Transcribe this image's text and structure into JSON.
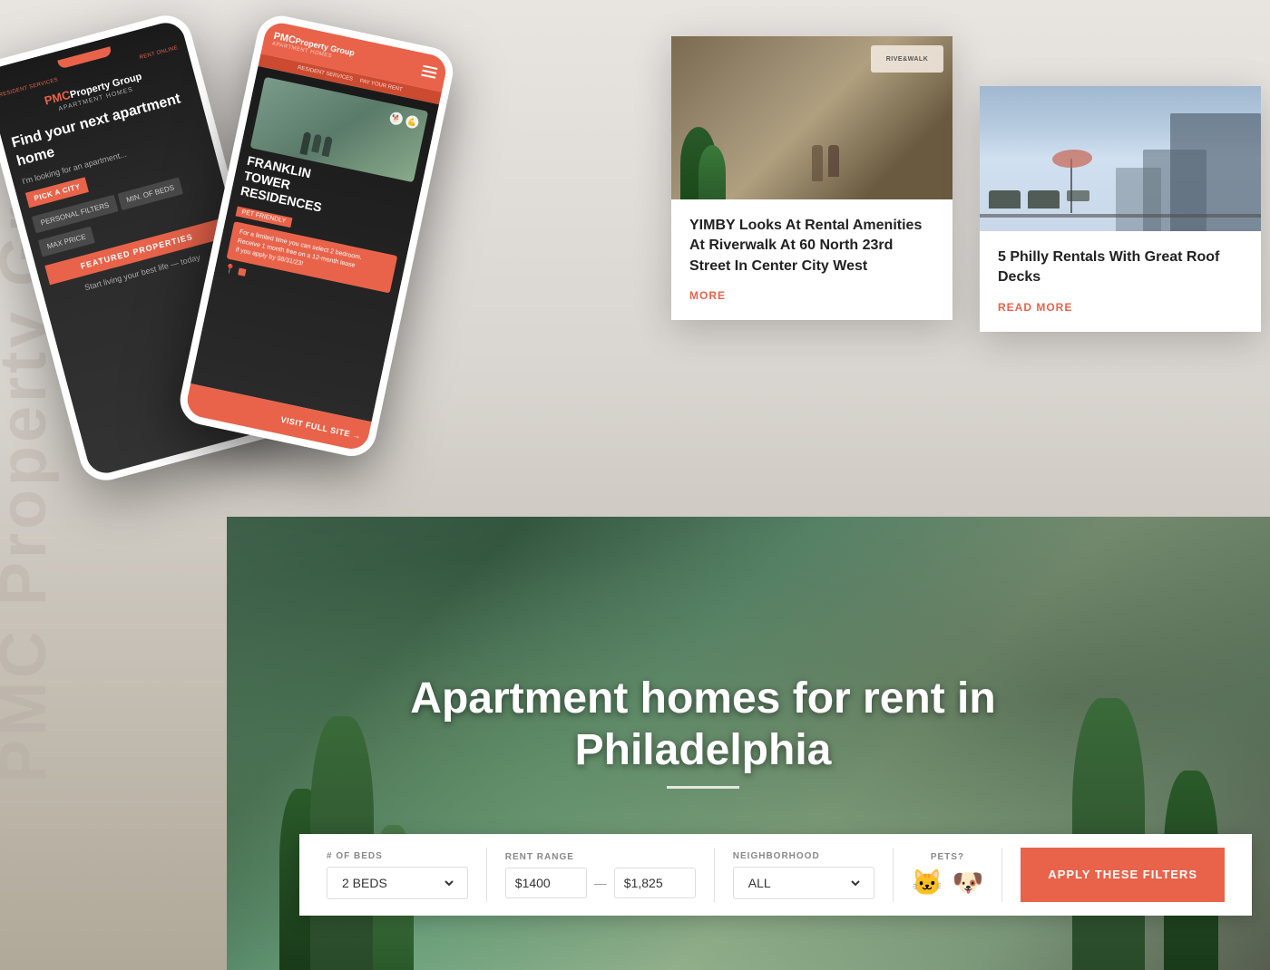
{
  "watermark": {
    "text": "PMC Property Group"
  },
  "hero": {
    "title_line1": "Apartment homes for rent in",
    "title_line2": "Philadelphia"
  },
  "filter_bar": {
    "beds_label": "# OF BEDS",
    "beds_value": "2 BEDS",
    "rent_label": "RENT RANGE",
    "rent_min": "$1400",
    "rent_max": "$1,825",
    "neighborhood_label": "NEIGHBORHOOD",
    "neighborhood_value": "ALL",
    "pets_label": "PETS?",
    "apply_button": "APPLY THESE FILTERS"
  },
  "blog_card_1": {
    "title": "YIMBY Looks At Rental Amenities At Riverwalk At 60 North 23rd Street In Center City West",
    "read_more": "MORE",
    "venue_logo": "RIVE&WALK"
  },
  "blog_card_2": {
    "title": "5 Philly Rentals With Great Roof Decks",
    "read_more": "READ MORE"
  },
  "phone_back": {
    "header": "RESIDENT SERVICES  |  PAY YOUR RENT ONLINE",
    "brand": "PMC Property Group",
    "brand_sub": "APARTMENT HOMES",
    "headline": "Find your next apartment home",
    "sub": "I'm looking for an apartment...",
    "cta": "PICK A CITY",
    "field1": "PERSONAL FILTERS",
    "field2": "MIN. OF BEDS",
    "field3": "MAX PRICE",
    "featured": "FEATURED PROPERTIES",
    "tagline": "Start living your best life — today"
  },
  "phone_front": {
    "header": "RESIDENT SERVICES  |  PAY YOUR RENT",
    "brand": "PMC",
    "brand_full": "PMCProperty Group",
    "brand_sub": "APARTMENT HOMES",
    "property_name": "FRANKLIN\nTOWER\nRESIDENCES",
    "badge": "PET FRIENDLY",
    "promo": "For a limited time you can select 2 bedroom.\nReceive 1 month free on a 12-month lease\nif you apply by 08/31/23!",
    "visit": "VISIT FULL SITE →"
  },
  "colors": {
    "brand_orange": "#e8634a",
    "dark_bg": "#1a1a1a",
    "text_dark": "#222222",
    "text_gray": "#888888"
  }
}
